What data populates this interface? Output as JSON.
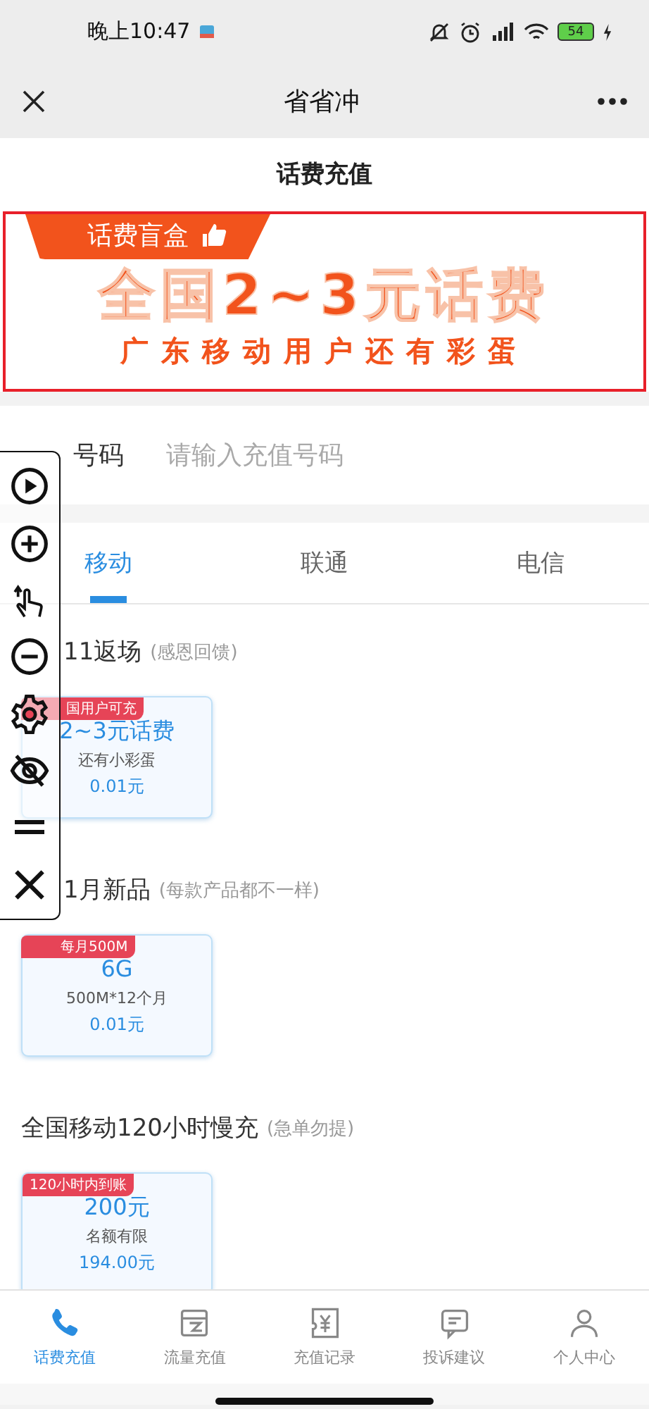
{
  "status_bar": {
    "time": "晚上10:47",
    "battery": "54"
  },
  "nav_bar": {
    "title": "省省冲"
  },
  "page_title": "话费充值",
  "banner": {
    "tag": "话费盲盒",
    "headline": "全国2~3元话费",
    "subline": "广东移动用户还有彩蛋"
  },
  "phone_input": {
    "label": "号码",
    "placeholder": "请输入充值号码"
  },
  "tabs": [
    {
      "label": "移动",
      "selected": true
    },
    {
      "label": "联通",
      "selected": false
    },
    {
      "label": "电信",
      "selected": false
    }
  ],
  "sections": [
    {
      "title": "11返场",
      "note": "(感恩回馈)",
      "products": [
        {
          "badge": "国用户可充",
          "name": "2~3元话费",
          "desc": "还有小彩蛋",
          "price": "0.01元"
        }
      ]
    },
    {
      "title": "1月新品",
      "note": "(每款产品都不一样)",
      "products": [
        {
          "badge": "每月500M",
          "name": "6G",
          "desc": "500M*12个月",
          "price": "0.01元"
        }
      ]
    },
    {
      "title": "全国移动120小时慢充",
      "note": "(急单勿提)",
      "products": [
        {
          "badge": "120小时内到账",
          "name": "200元",
          "desc": "名额有限",
          "price": "194.00元"
        }
      ]
    }
  ],
  "bottom_nav": [
    {
      "label": "话费充值",
      "selected": true
    },
    {
      "label": "流量充值",
      "selected": false
    },
    {
      "label": "充值记录",
      "selected": false
    },
    {
      "label": "投诉建议",
      "selected": false
    },
    {
      "label": "个人中心",
      "selected": false
    }
  ]
}
